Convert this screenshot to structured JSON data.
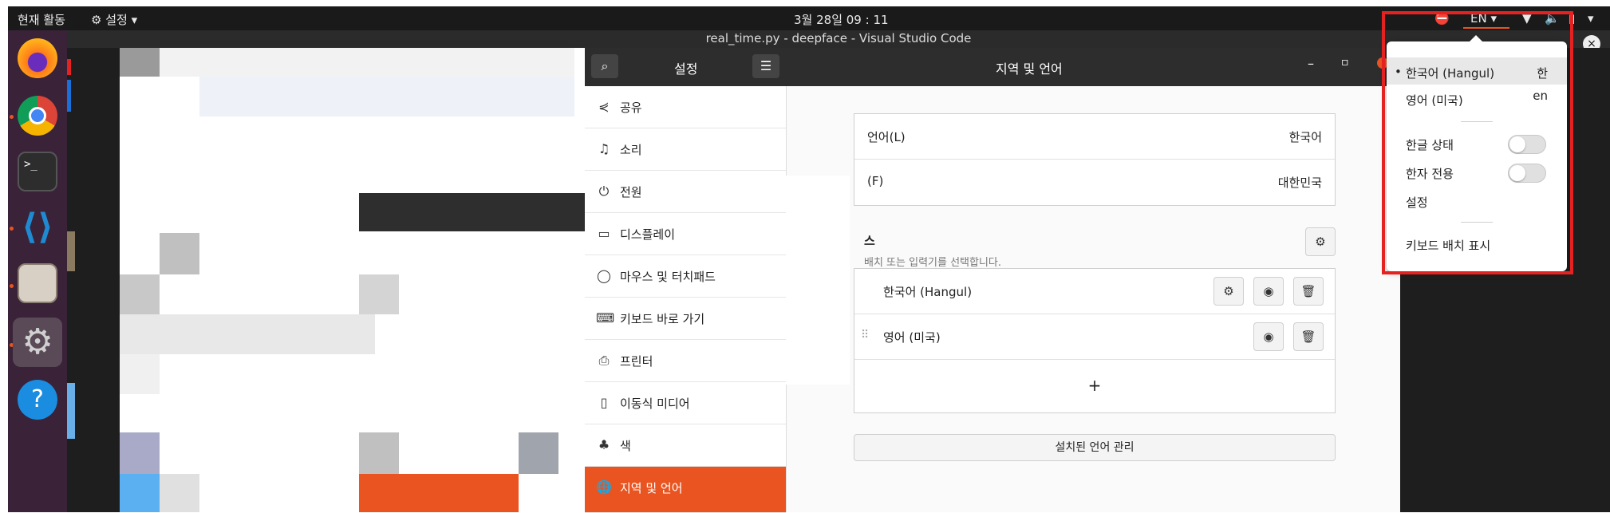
{
  "topbar": {
    "activities": "현재 활동",
    "app_menu": "설정",
    "clock": "3월 28일 09 : 11",
    "input_source": "EN"
  },
  "vscode": {
    "title": "real_time.py - deepface - Visual Studio Code"
  },
  "settings": {
    "sidebar_title": "설정",
    "page_title": "지역 및 언어",
    "sidebar": [
      {
        "label": "공유",
        "icon": "share-icon"
      },
      {
        "label": "소리",
        "icon": "music-note-icon"
      },
      {
        "label": "전원",
        "icon": "power-icon"
      },
      {
        "label": "디스플레이",
        "icon": "display-icon"
      },
      {
        "label": "마우스 및 터치패드",
        "icon": "mouse-icon"
      },
      {
        "label": "키보드 바로 가기",
        "icon": "keyboard-icon"
      },
      {
        "label": "프린터",
        "icon": "printer-icon"
      },
      {
        "label": "이동식 미디어",
        "icon": "removable-media-icon"
      },
      {
        "label": "색",
        "icon": "color-icon"
      },
      {
        "label": "지역 및 언어",
        "icon": "globe-icon"
      }
    ],
    "language_label": "언어(L)",
    "language_value": "한국어",
    "formats_label": "(F)",
    "formats_value": "대한민국",
    "input_heading": "스",
    "input_desc": "배치 또는 입력기를 선택합니다.",
    "sources": [
      "한국어 (Hangul)",
      "영어 (미국)"
    ],
    "add_label": "+",
    "manage_button": "설치된 언어 관리"
  },
  "popup": {
    "items": [
      {
        "label": "한국어 (Hangul)",
        "short": "한"
      },
      {
        "label": "영어 (미국)",
        "short": "en"
      }
    ],
    "hangul_state": "한글 상태",
    "hanja_only": "한자 전용",
    "settings": "설정",
    "show_layout": "키보드 배치 표시"
  },
  "colors": {
    "accent": "#e95420",
    "highlight_box": "#e52222",
    "dock": "#3a2238"
  }
}
